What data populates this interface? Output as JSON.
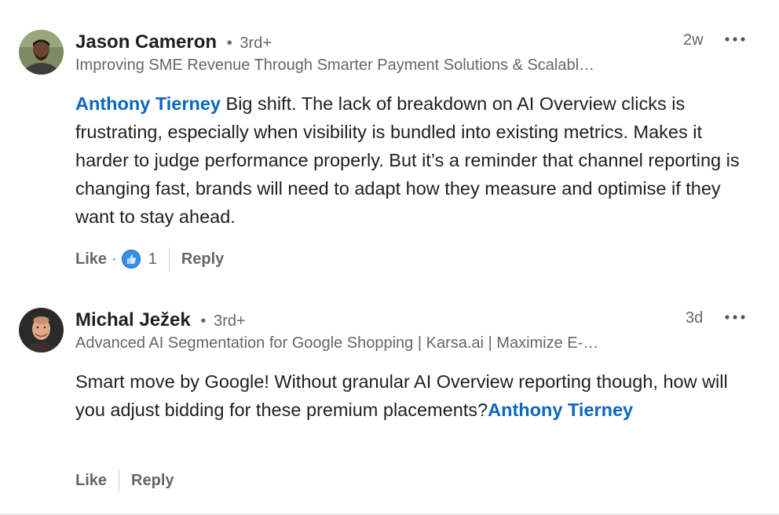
{
  "comments": [
    {
      "author": "Jason Cameron",
      "degree": "3rd+",
      "headline": "Improving SME Revenue Through Smarter Payment Solutions & Scalabl…",
      "timestamp": "2w",
      "mention": "Anthony Tierney",
      "text": " Big shift. The lack of breakdown on AI Overview clicks is frustrating, especially when visibility is bundled into existing metrics. Makes it harder to judge performance properly. But it’s a reminder that channel reporting is changing fast, brands will need to adapt how they measure and optimise if they want to stay ahead.",
      "like_label": "Like",
      "reaction_count": "1",
      "reply_label": "Reply"
    },
    {
      "author": "Michal Ježek",
      "degree": "3rd+",
      "headline": "Advanced AI Segmentation for Google Shopping | Karsa.ai | Maximize E-…",
      "timestamp": "3d",
      "text": "Smart move by Google! Without granular AI Overview reporting though, how will you adjust bidding for these premium placements?",
      "mention": "Anthony Tierney",
      "like_label": "Like",
      "reply_label": "Reply"
    }
  ],
  "icons": {
    "more": "more-options-icon",
    "reaction": "like-reaction-icon"
  },
  "colors": {
    "mention": "#0a66c2",
    "secondary_text": "#666666",
    "primary_text": "#1f1f1f",
    "reaction_blue": "#378fe9"
  }
}
